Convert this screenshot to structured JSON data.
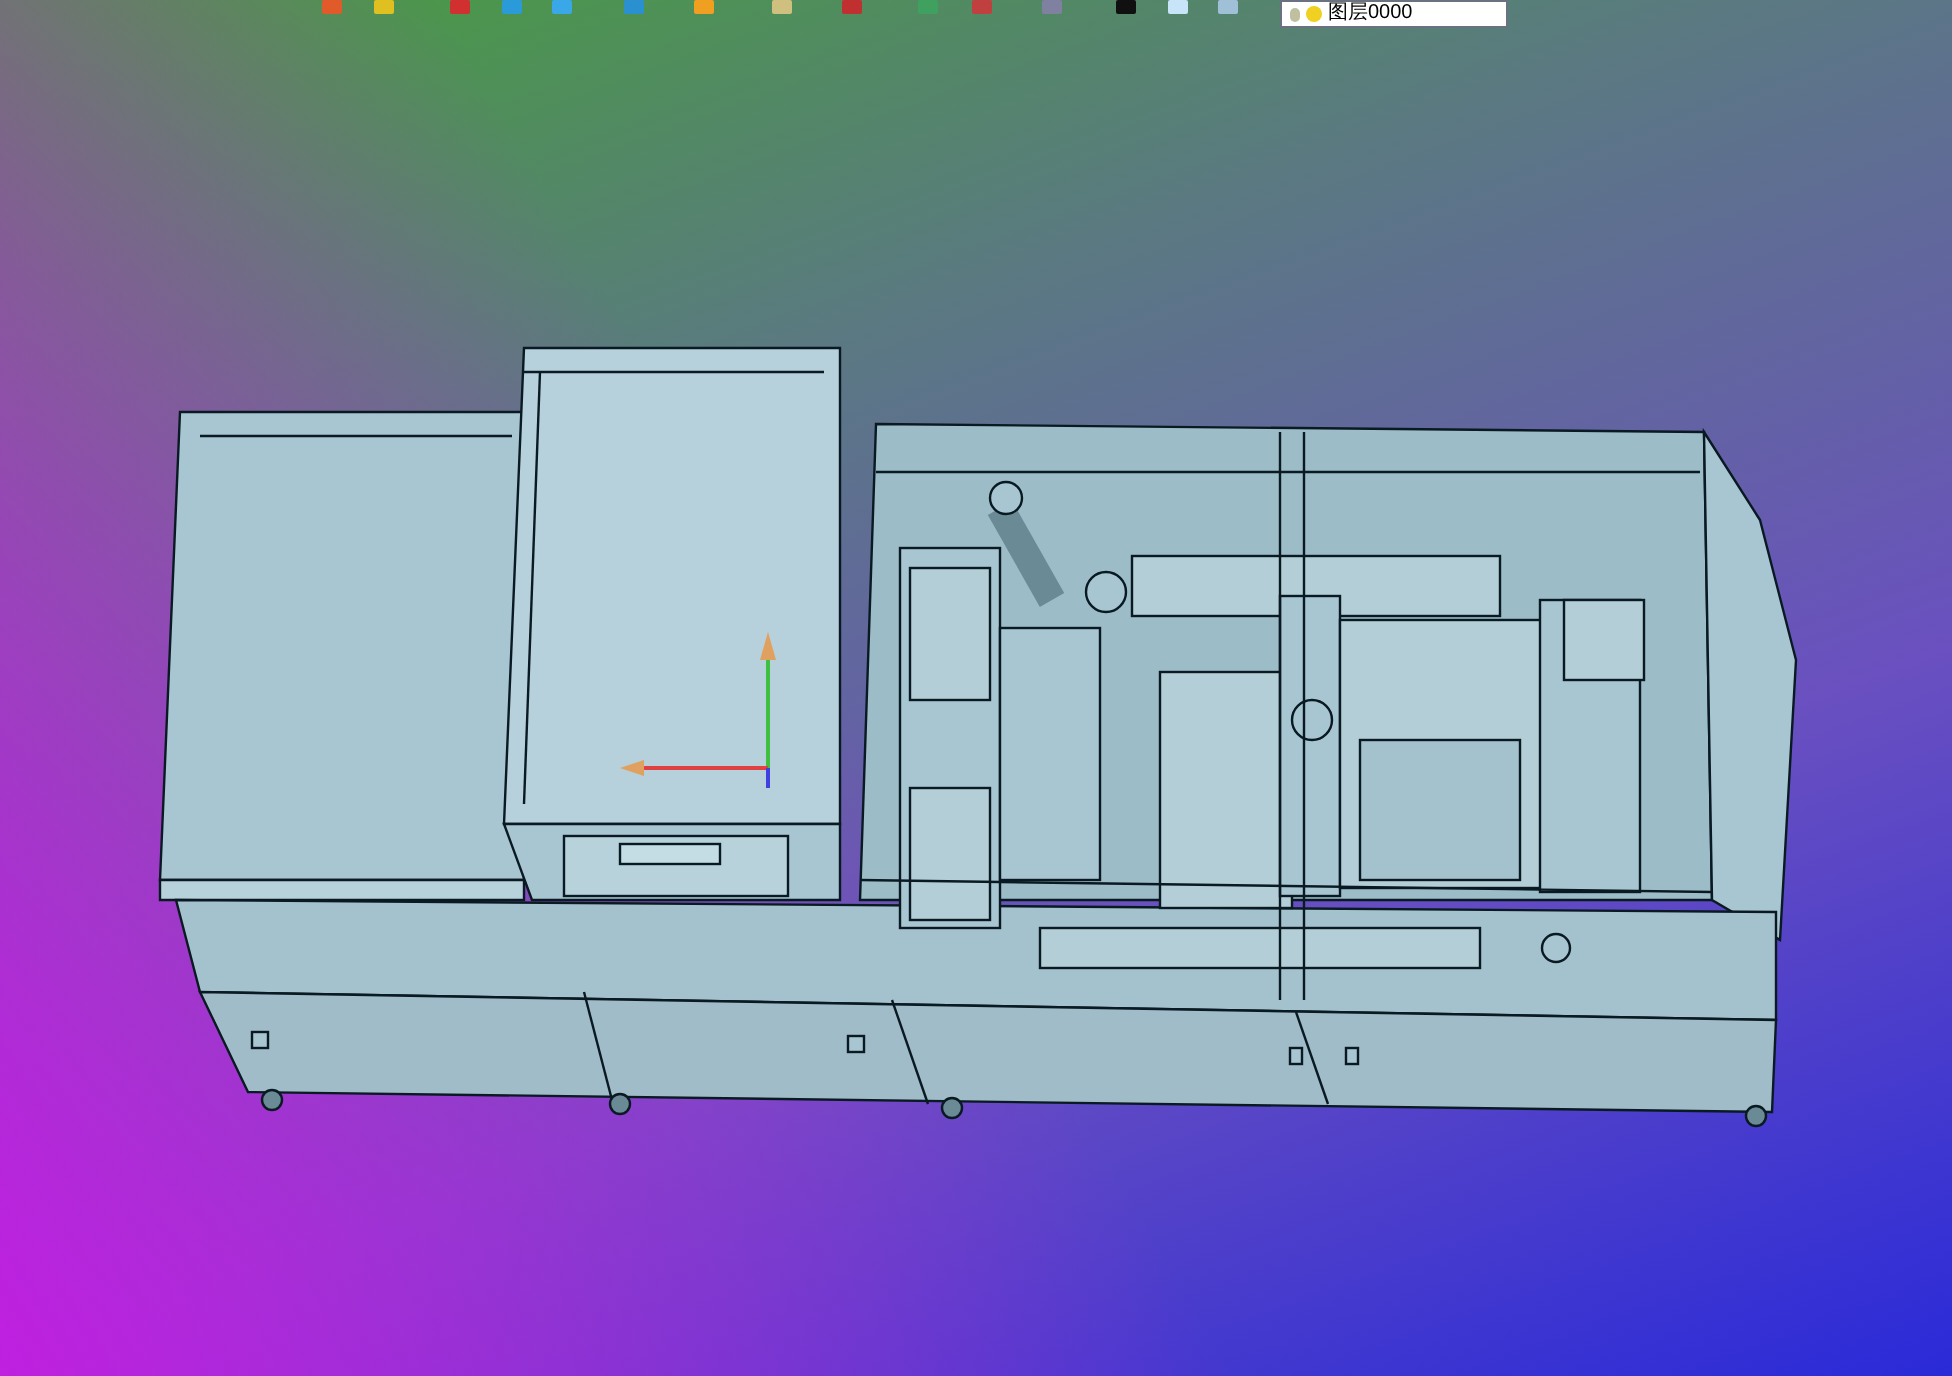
{
  "toolbar": {
    "layer_field": {
      "value": "图层0000"
    }
  }
}
